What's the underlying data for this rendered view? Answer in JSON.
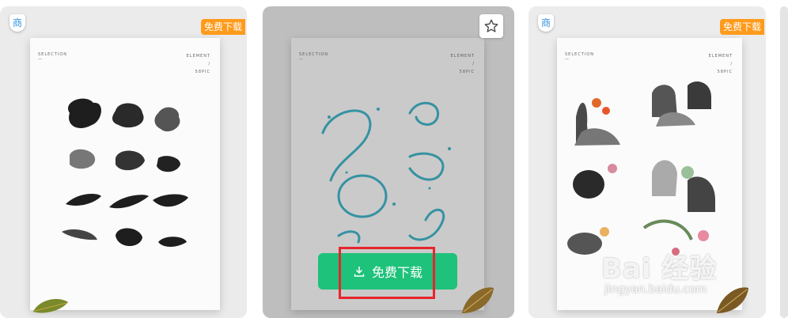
{
  "cards": [
    {
      "badge": "商",
      "tag": "免费下载",
      "poster_left": "SELECTION",
      "poster_left_sub": "—",
      "poster_right": [
        "ELEMENT",
        "/",
        "58PIC"
      ],
      "theme": "ink brush strokes"
    },
    {
      "poster_left": "SELECTION",
      "poster_left_sub": "—",
      "poster_right": [
        "ELEMENT",
        "/",
        "58PIC"
      ],
      "theme": "water splash",
      "download_button": "免费下载",
      "favorite_icon": "star-icon",
      "download_icon": "download-icon"
    },
    {
      "badge": "商",
      "tag": "免费下载",
      "poster_left": "SELECTION",
      "poster_left_sub": "—",
      "poster_right": [
        "ELEMENT",
        "/",
        "58PIC"
      ],
      "theme": "chinese ink painting"
    }
  ],
  "watermark": {
    "main": "Bai 经验",
    "sub": "jingyan.baidu.com"
  },
  "colors": {
    "download_button": "#1ec27a",
    "free_tag": "#ff9b1c",
    "highlight_box": "#e8242c",
    "badge_text": "#2f8fe0"
  }
}
